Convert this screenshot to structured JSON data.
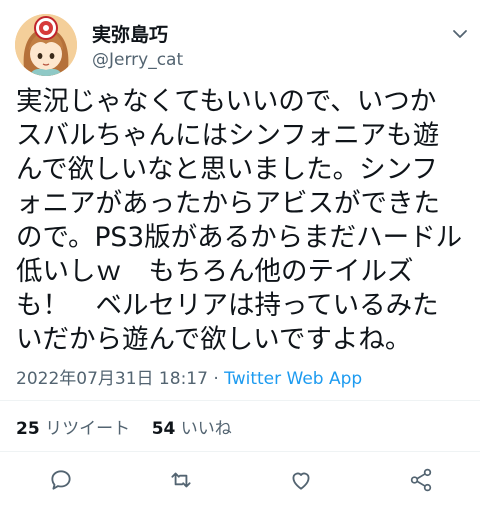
{
  "tweet": {
    "display_name": "実弥島巧",
    "handle": "@Jerry_cat",
    "text_lines": [
      "実況じゃなくてもいいので、いつか",
      "スバルちゃんにはシンフォニアも遊",
      "んで欲しいなと思いました。シンフ",
      "ォニアがあったからアビスができた",
      "ので。PS3版があるからまだハードル",
      "低いしｗ　もちろん他のテイルズ",
      "も！　ベルセリアは持っているみた",
      "いだから遊んで欲しいですよね。"
    ],
    "timestamp": "2022年07月31日 18:17",
    "separator": " · ",
    "source": "Twitter Web App"
  },
  "stats": {
    "retweets_count": "25",
    "retweets_label": "リツイート",
    "likes_count": "54",
    "likes_label": "いいね"
  },
  "icons": {
    "more": "chevron-down-icon",
    "reply": "reply-icon",
    "retweet": "retweet-icon",
    "like": "heart-icon",
    "share": "share-icon"
  },
  "colors": {
    "text": "#0f1419",
    "secondary": "#536471",
    "link": "#1d9bf0",
    "divider": "#eff3f4"
  }
}
